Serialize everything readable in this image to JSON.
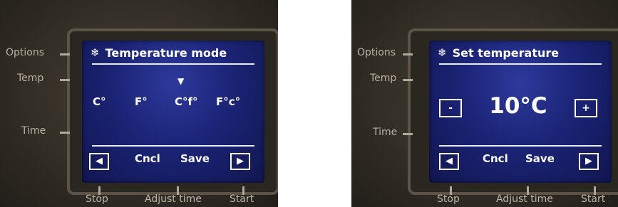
{
  "panels": [
    {
      "side_labels": [
        "Options",
        "Temp",
        "Time"
      ],
      "bottom_labels": [
        "Stop",
        "Adjust time",
        "Start"
      ],
      "screen": {
        "header_icon": "❄",
        "title": "Temperature mode",
        "options": [
          "C°",
          "F°",
          "C°f°",
          "F°c°"
        ],
        "selected_marker": "▼",
        "nav_left": "◀",
        "nav_right": "▶",
        "cancel_label": "Cncl",
        "save_label": "Save"
      }
    },
    {
      "side_labels": [
        "Options",
        "Temp",
        "Time"
      ],
      "bottom_labels": [
        "Stop",
        "Adjust time",
        "Start"
      ],
      "screen": {
        "header_icon": "❄",
        "title": "Set temperature",
        "decrease_label": "-",
        "increase_label": "+",
        "value": "10°C",
        "nav_left": "◀",
        "nav_right": "▶",
        "cancel_label": "Cncl",
        "save_label": "Save"
      }
    }
  ]
}
